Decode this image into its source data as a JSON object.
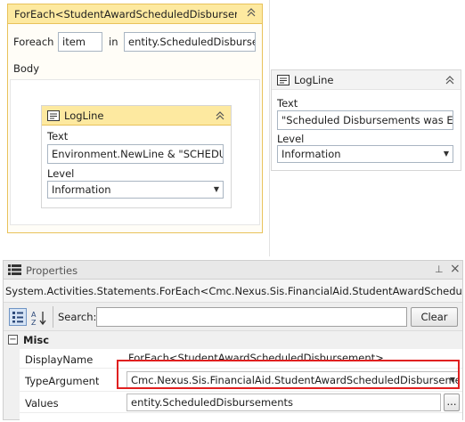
{
  "foreach": {
    "title": "ForEach<StudentAwardScheduledDisburser",
    "foreach_label": "Foreach",
    "item_value": "item",
    "in_label": "in",
    "in_value": "entity.ScheduledDisburser",
    "body_label": "Body"
  },
  "inner_logline": {
    "title": "LogLine",
    "text_label": "Text",
    "text_value": "Environment.NewLine & \"SCHEDUL",
    "level_label": "Level",
    "level_value": "Information"
  },
  "right_logline": {
    "title": "LogLine",
    "text_label": "Text",
    "text_value": "\"Scheduled Disbursements was Emp",
    "level_label": "Level",
    "level_value": "Information"
  },
  "properties": {
    "title": "Properties",
    "pin_glyph": "⊥",
    "close_glyph": "×",
    "object_type": "System.Activities.Statements.ForEach<Cmc.Nexus.Sis.FinancialAid.StudentAwardScheduledDi...",
    "search_label": "Search:",
    "search_value": "",
    "clear_label": "Clear",
    "category": "Misc",
    "category_toggle": "−",
    "rows": [
      {
        "name": "DisplayName",
        "value": "ForEach<StudentAwardScheduledDisbursement>"
      },
      {
        "name": "TypeArgument",
        "value": "Cmc.Nexus.Sis.FinancialAid.StudentAwardScheduledDisbursement"
      },
      {
        "name": "Values",
        "value": "entity.ScheduledDisbursements",
        "button": "..."
      }
    ]
  },
  "colors": {
    "selection_header": "#fde9a0",
    "selection_border": "#e8c25a",
    "annotation_red": "#e02020"
  },
  "icons": [
    "collapse-up-icon",
    "logline-activity-icon",
    "dropdown-arrow-icon",
    "properties-icon",
    "pin-icon",
    "close-icon",
    "categorized-sort-icon",
    "alphabetical-sort-icon"
  ]
}
